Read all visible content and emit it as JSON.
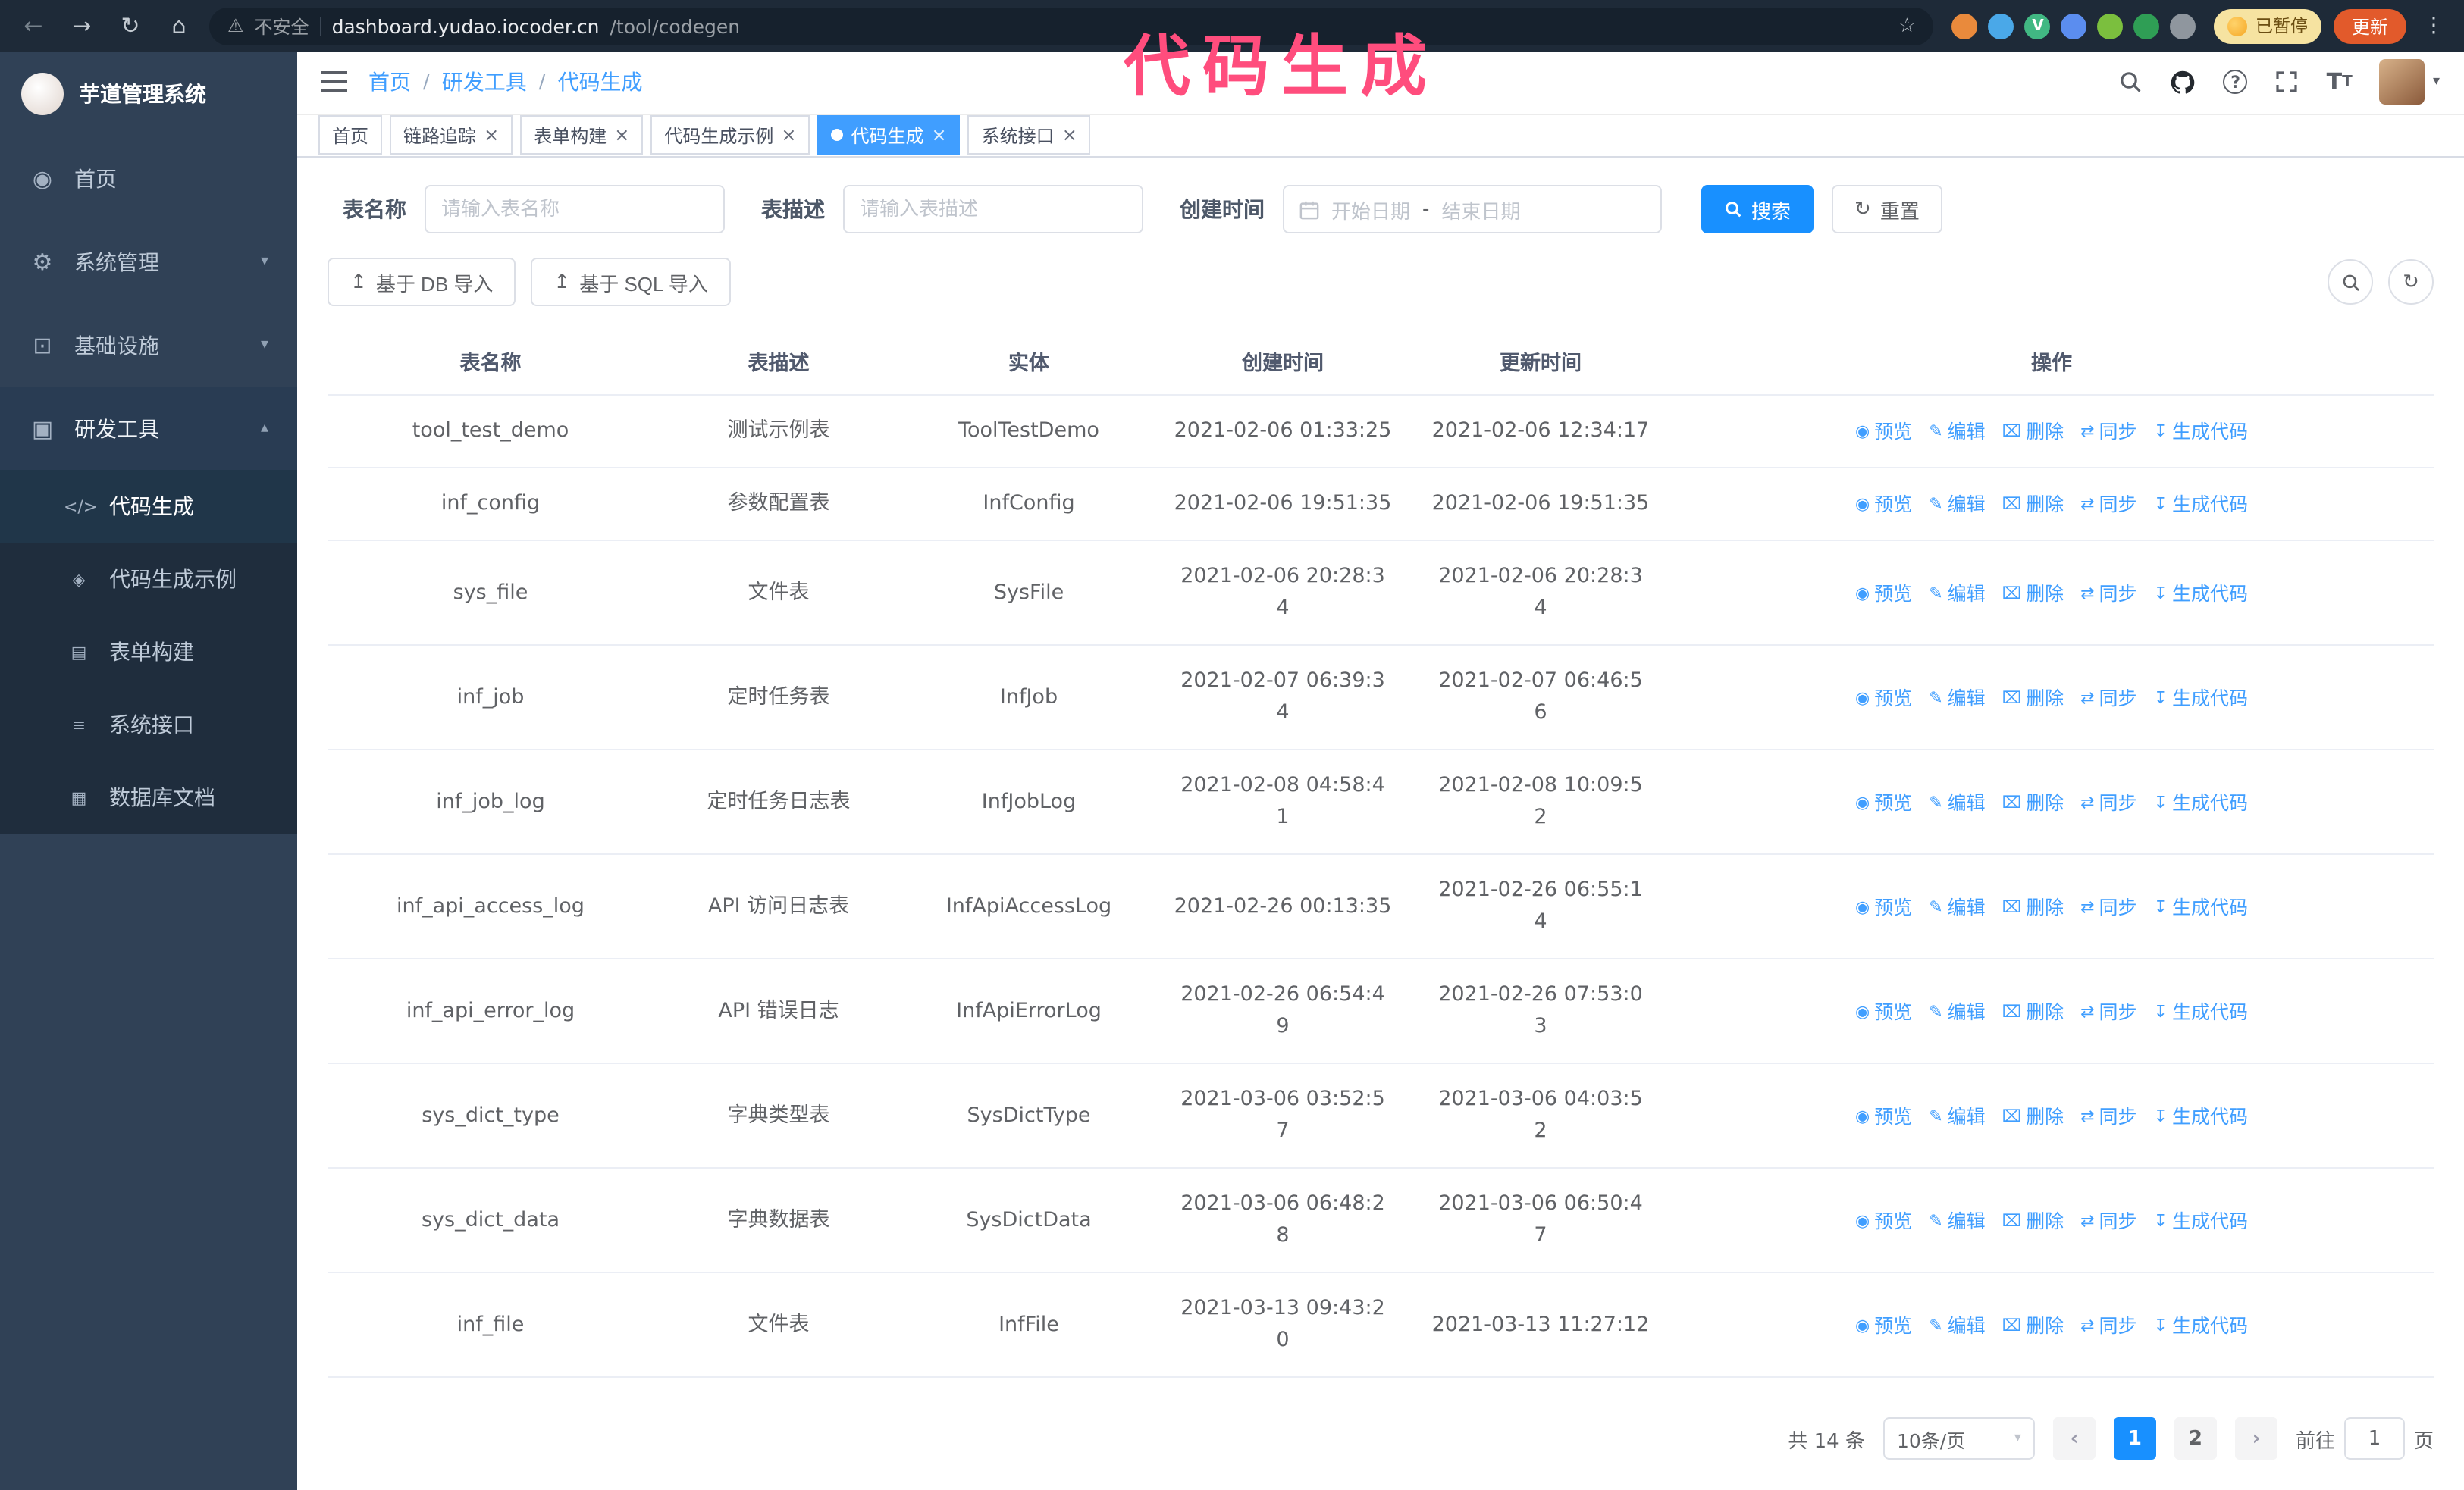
{
  "annotation": {
    "text": "代码生成",
    "color": "#ff4d7d"
  },
  "colors": {
    "accent": "#409eff",
    "primary_button": "#1890ff",
    "sidebar_bg": "#304156",
    "submenu_bg": "#1f2d3d",
    "chrome_bg": "#1e2a38"
  },
  "icons": {
    "back": "←",
    "forward": "→",
    "reload": "↻",
    "home": "⌂",
    "warning": "⚠",
    "star": "☆",
    "kebab": "⋮",
    "caret_down": "▾",
    "reset": "↻",
    "refresh": "↻",
    "upload": "↥",
    "tt_big": "T",
    "tt_small": "T",
    "question": "?"
  },
  "browser": {
    "security_label": "不安全",
    "url_host": "dashboard.yudao.iocoder.cn",
    "url_path": "/tool/codegen",
    "paused_label": "已暂停",
    "update_label": "更新",
    "extensions": [
      {
        "name": "extension-fox",
        "color": "#e98a3c",
        "glyph": ""
      },
      {
        "name": "extension-drop",
        "color": "#4aa8e8",
        "glyph": ""
      },
      {
        "name": "extension-vue",
        "color": "#41b883",
        "glyph": "V"
      },
      {
        "name": "extension-people",
        "color": "#5b8def",
        "glyph": ""
      },
      {
        "name": "extension-capture",
        "color": "#7bbf3e",
        "glyph": ""
      },
      {
        "name": "extension-green",
        "color": "#2f9e55",
        "glyph": ""
      },
      {
        "name": "extension-puzzle",
        "color": "#8f969e",
        "glyph": ""
      }
    ]
  },
  "sidebar": {
    "logo_title": "芋道管理系统",
    "items": [
      {
        "label": "首页",
        "glyph": "◉",
        "chev": ""
      },
      {
        "label": "系统管理",
        "glyph": "⚙",
        "chev": "▾"
      },
      {
        "label": "基础设施",
        "glyph": "⊡",
        "chev": "▾"
      },
      {
        "label": "研发工具",
        "glyph": "▣",
        "chev": "▴",
        "open": true
      }
    ],
    "submenu": [
      {
        "label": "代码生成",
        "glyph": "</>",
        "active": true
      },
      {
        "label": "代码生成示例",
        "glyph": "◈"
      },
      {
        "label": "表单构建",
        "glyph": "▤"
      },
      {
        "label": "系统接口",
        "glyph": "≡"
      },
      {
        "label": "数据库文档",
        "glyph": "▦"
      }
    ]
  },
  "header": {
    "breadcrumb": [
      "首页",
      "研发工具",
      "代码生成"
    ],
    "separator": "/"
  },
  "tabs": [
    {
      "label": "首页",
      "closable": false
    },
    {
      "label": "链路追踪"
    },
    {
      "label": "表单构建"
    },
    {
      "label": "代码生成示例"
    },
    {
      "label": "代码生成",
      "active": true
    },
    {
      "label": "系统接口"
    }
  ],
  "tab_close_glyph": "×",
  "filters": {
    "name_label": "表名称",
    "name_placeholder": "请输入表名称",
    "desc_label": "表描述",
    "desc_placeholder": "请输入表描述",
    "time_label": "创建时间",
    "start_placeholder": "开始日期",
    "range_separator": "-",
    "end_placeholder": "结束日期",
    "search_label": "搜索",
    "reset_label": "重置"
  },
  "toolbar": {
    "db_import_label": "基于 DB 导入",
    "sql_import_label": "基于 SQL 导入"
  },
  "table": {
    "columns": [
      {
        "label": "表名称"
      },
      {
        "label": "表描述"
      },
      {
        "label": "实体"
      },
      {
        "label": "创建时间"
      },
      {
        "label": "更新时间"
      },
      {
        "label": "操作"
      }
    ],
    "row_actions": [
      {
        "label": "预览",
        "name": "preview-link",
        "icon": "eye-icon",
        "glyph": "◉"
      },
      {
        "label": "编辑",
        "name": "edit-link",
        "icon": "pencil-icon",
        "glyph": "✎"
      },
      {
        "label": "删除",
        "name": "delete-link",
        "icon": "trash-icon",
        "glyph": "⌧"
      },
      {
        "label": "同步",
        "name": "sync-link",
        "icon": "sync-icon",
        "glyph": "⇄"
      },
      {
        "label": "生成代码",
        "name": "generate-code-link",
        "icon": "download-icon",
        "glyph": "↧"
      }
    ],
    "rows": [
      {
        "name": "tool_test_demo",
        "desc": "测试示例表",
        "entity": "ToolTestDemo",
        "created": "2021-02-06 01:33:25",
        "updated": "2021-02-06 12:34:17"
      },
      {
        "name": "inf_config",
        "desc": "参数配置表",
        "entity": "InfConfig",
        "created": "2021-02-06 19:51:35",
        "updated": "2021-02-06 19:51:35"
      },
      {
        "name": "sys_file",
        "desc": "文件表",
        "entity": "SysFile",
        "created": "2021-02-06 20:28:3\n4",
        "updated": "2021-02-06 20:28:3\n4"
      },
      {
        "name": "inf_job",
        "desc": "定时任务表",
        "entity": "InfJob",
        "created": "2021-02-07 06:39:3\n4",
        "updated": "2021-02-07 06:46:5\n6"
      },
      {
        "name": "inf_job_log",
        "desc": "定时任务日志表",
        "entity": "InfJobLog",
        "created": "2021-02-08 04:58:4\n1",
        "updated": "2021-02-08 10:09:5\n2"
      },
      {
        "name": "inf_api_access_log",
        "desc": "API 访问日志表",
        "entity": "InfApiAccessLog",
        "created": "2021-02-26 00:13:35",
        "updated": "2021-02-26 06:55:1\n4"
      },
      {
        "name": "inf_api_error_log",
        "desc": "API 错误日志",
        "entity": "InfApiErrorLog",
        "created": "2021-02-26 06:54:4\n9",
        "updated": "2021-02-26 07:53:0\n3"
      },
      {
        "name": "sys_dict_type",
        "desc": "字典类型表",
        "entity": "SysDictType",
        "created": "2021-03-06 03:52:5\n7",
        "updated": "2021-03-06 04:03:5\n2"
      },
      {
        "name": "sys_dict_data",
        "desc": "字典数据表",
        "entity": "SysDictData",
        "created": "2021-03-06 06:48:2\n8",
        "updated": "2021-03-06 06:50:4\n7"
      },
      {
        "name": "inf_file",
        "desc": "文件表",
        "entity": "InfFile",
        "created": "2021-03-13 09:43:2\n0",
        "updated": "2021-03-13 11:27:12"
      }
    ]
  },
  "pagination": {
    "total_label": "共 14 条",
    "page_size_label": "10条/页",
    "prev_icon": "‹",
    "next_icon": "›",
    "pages": [
      {
        "label": "1",
        "active": true
      },
      {
        "label": "2"
      }
    ],
    "goto_label": "前往",
    "goto_value": "1",
    "goto_suffix": "页"
  }
}
